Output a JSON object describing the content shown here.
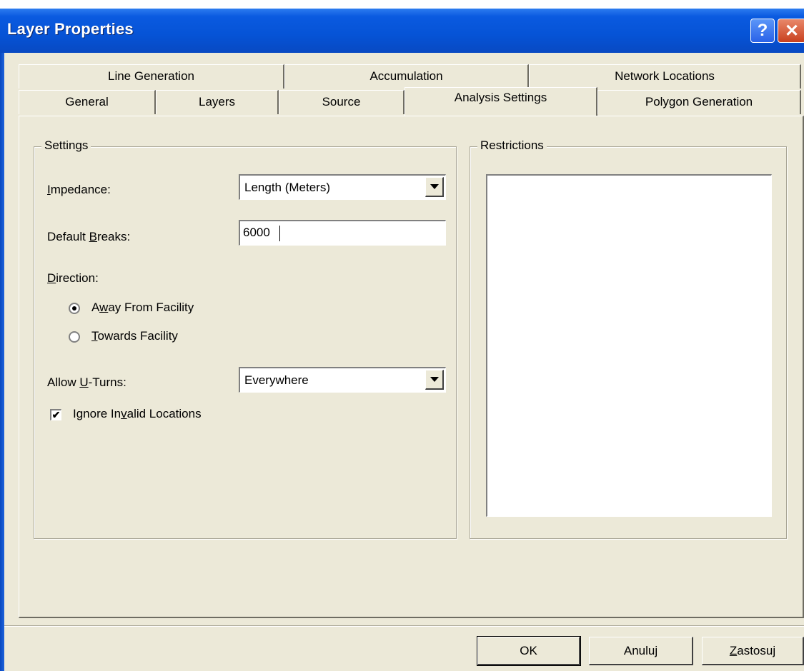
{
  "window": {
    "title": "Layer Properties",
    "help_label": "?",
    "close_label": "✕"
  },
  "tabs": {
    "back_row": [
      "Line Generation",
      "Accumulation",
      "Network Locations"
    ],
    "front_row": [
      "General",
      "Layers",
      "Source",
      "Analysis Settings",
      "Polygon Generation"
    ],
    "active": "Analysis Settings"
  },
  "settings": {
    "legend": "Settings",
    "impedance": {
      "label_pre": "",
      "label_ul": "I",
      "label_post": "mpedance:",
      "value": "Length (Meters)"
    },
    "default_breaks": {
      "label_pre": "Default ",
      "label_ul": "B",
      "label_post": "reaks:",
      "value": "6000"
    },
    "direction": {
      "label_pre": "",
      "label_ul": "D",
      "label_post": "irection:",
      "away": {
        "pre": "A",
        "ul": "w",
        "post": "ay From Facility",
        "selected": true
      },
      "towards": {
        "pre": "",
        "ul": "T",
        "post": "owards Facility",
        "selected": false
      }
    },
    "uturns": {
      "label_pre": "Allow ",
      "label_ul": "U",
      "label_post": "-Turns:",
      "value": "Everywhere"
    },
    "ignore_invalid": {
      "pre": "Ignore In",
      "ul": "v",
      "post": "alid Locations",
      "checked": true,
      "mark": "✔"
    }
  },
  "restrictions": {
    "legend": "Restrictions"
  },
  "buttons": {
    "ok": "OK",
    "cancel": "Anuluj",
    "apply_ul": "Z",
    "apply_post": "astosuj"
  }
}
